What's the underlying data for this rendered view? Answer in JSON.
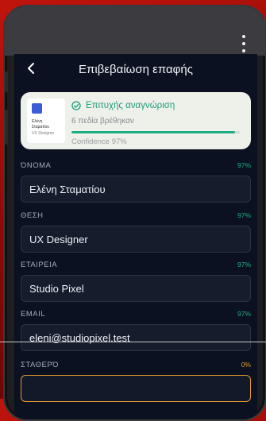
{
  "header": {
    "title": "Επιβεβαίωση επαφής"
  },
  "scan_card": {
    "status": "Επιτυχής αναγνώριση",
    "subtitle": "6 πεδία βρέθηκαν",
    "progress": 0.97,
    "confidence_text": "Confidence 97%",
    "thumbnail": {
      "name_line1": "Ελένη",
      "name_line2": "Σταματίου",
      "role": "UX Designer"
    }
  },
  "fields": [
    {
      "label": "ΌΝΟΜΑ",
      "confidence": "97%",
      "value": "Ελένη Σταματίου"
    },
    {
      "label": "ΘΕΣΗ",
      "confidence": "97%",
      "value": "UX Designer"
    },
    {
      "label": "ΕΤΑΙΡΕΙΑ",
      "confidence": "97%",
      "value": "Studio Pixel"
    },
    {
      "label": "EMAIL",
      "confidence": "97%",
      "value": "eleni@studiopixel.test"
    },
    {
      "label": "ΣΤΑΘΕΡΌ",
      "confidence": "0%",
      "value": ""
    }
  ],
  "colors": {
    "accent": "#1fae84",
    "warning": "#e39a2d",
    "background": "#0b1120"
  },
  "icons": {
    "back": "back-arrow-icon",
    "menu": "more-vert-icon",
    "status": "check-circle-icon"
  }
}
